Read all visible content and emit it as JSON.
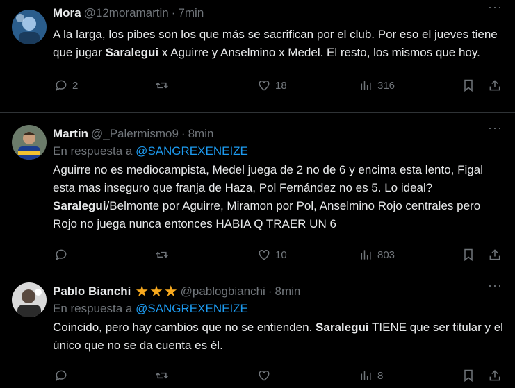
{
  "tweets": [
    {
      "name": "Mora",
      "handle": "@12moramartin",
      "time": "7min",
      "reply_label": "",
      "reply_to": "",
      "text_parts": [
        "A la larga, los pibes son los que más se sacrifican por el club. Por eso el jueves tiene que jugar ",
        "Saralegui",
        " x Aguirre y Anselmino x Medel. El resto, los mismos que hoy."
      ],
      "replies": "2",
      "retweets": "",
      "likes": "18",
      "views": "316"
    },
    {
      "name": "Martin",
      "handle": "@_Palermismo9",
      "time": "8min",
      "reply_label": "En respuesta a",
      "reply_to": "@SANGREXENEIZE",
      "text_parts": [
        "Aguirre no es mediocampista, Medel juega de 2 no de 6 y encima esta lento, Figal esta mas inseguro que franja de Haza, Pol Fernández no es 5. Lo ideal? ",
        "Saralegui",
        "/Belmonte por Aguirre, Miramon por Pol, Anselmino Rojo centrales pero Rojo no juega nunca entonces HABIA Q TRAER UN 6"
      ],
      "replies": "",
      "retweets": "",
      "likes": "10",
      "views": "803"
    },
    {
      "name": "Pablo Bianchi",
      "handle": "@pablogbianchi",
      "time": "8min",
      "reply_label": "En respuesta a",
      "reply_to": "@SANGREXENEIZE",
      "text_parts": [
        "Coincido, pero hay cambios que no se entienden. ",
        "Saralegui",
        " TIENE que ser titular y el único que no se da cuenta es él."
      ],
      "replies": "",
      "retweets": "",
      "likes": "",
      "views": "8"
    }
  ],
  "colors": {
    "background": "#000000",
    "text": "#e7e9ea",
    "muted": "#71767b",
    "link": "#1d9bf0",
    "star": "#f7a91e"
  },
  "icons": [
    "reply-icon",
    "retweet-icon",
    "like-icon",
    "views-icon",
    "bookmark-icon",
    "share-icon",
    "more-icon",
    "star-icon"
  ]
}
